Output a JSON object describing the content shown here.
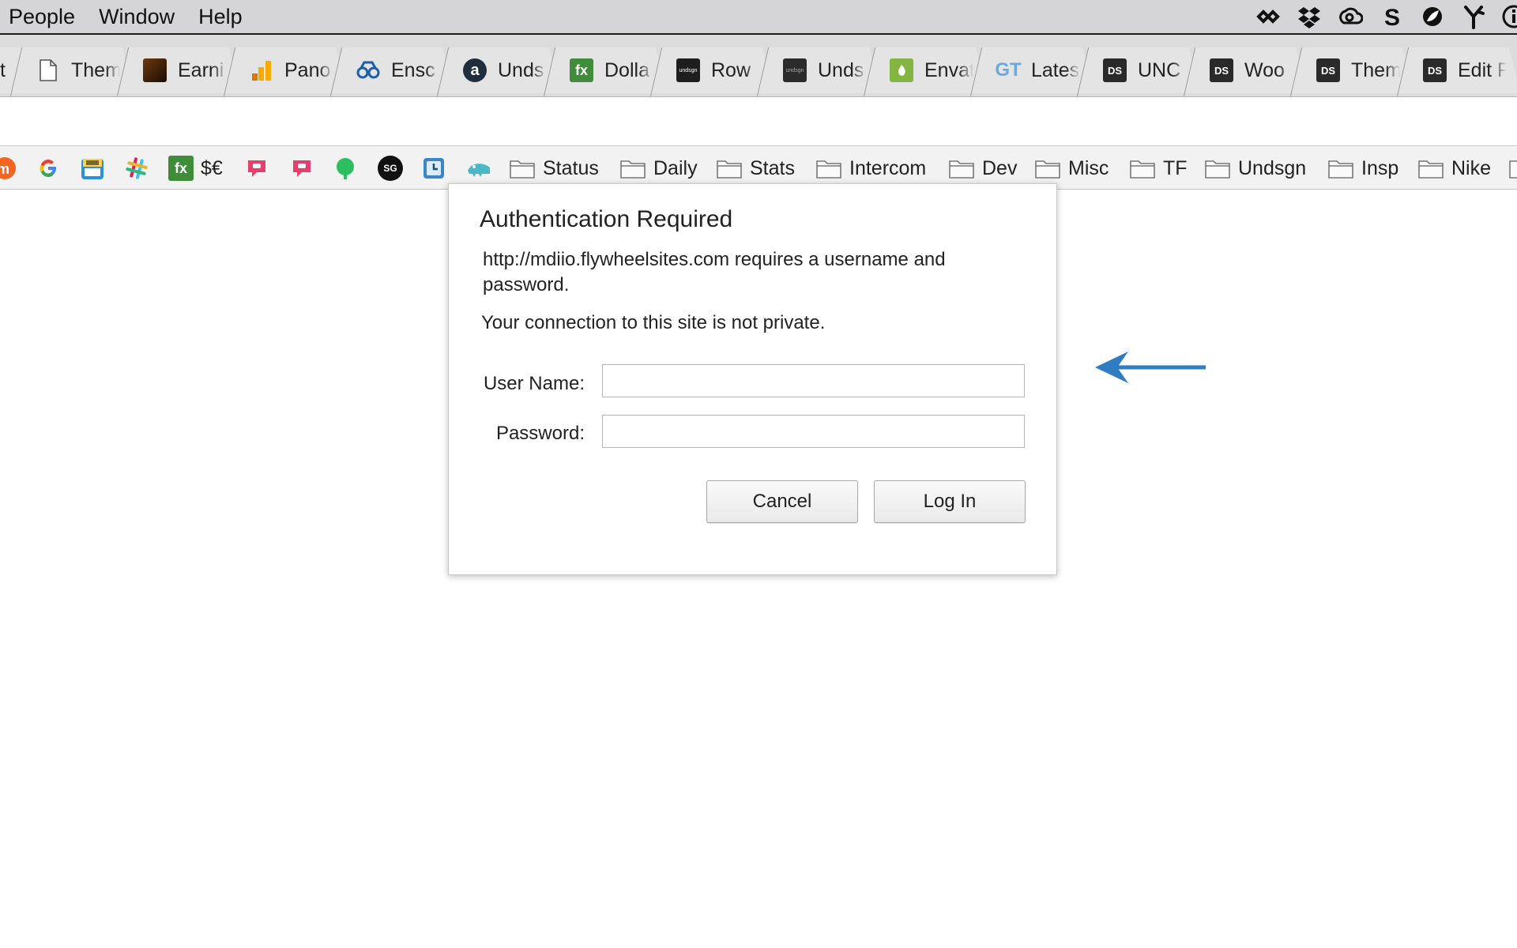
{
  "menubar": {
    "items": [
      "People",
      "Window",
      "Help"
    ],
    "extras": [
      "link-icon",
      "dropbox-icon",
      "creative-cloud-icon",
      "scrivener-icon",
      "leaf-icon",
      "branch-icon",
      "info-icon"
    ]
  },
  "tabs": [
    {
      "title": "Them",
      "icon": "page-icon"
    },
    {
      "title": "Earni",
      "icon": "earnings-icon"
    },
    {
      "title": "Pano",
      "icon": "analytics-icon"
    },
    {
      "title": "Ensc",
      "icon": "binoculars-icon"
    },
    {
      "title": "Unds",
      "icon": "amazon-icon"
    },
    {
      "title": "Dolla",
      "icon": "fx-icon",
      "fav_text": "fx"
    },
    {
      "title": "Row",
      "icon": "undsgn-icon",
      "fav_text": "undsgn"
    },
    {
      "title": "Unds",
      "icon": "undsgn-icon",
      "fav_text": "undsgn"
    },
    {
      "title": "Envat",
      "icon": "envato-icon"
    },
    {
      "title": "Lates",
      "icon": "gt-icon",
      "fav_text": "GT"
    },
    {
      "title": "UNC",
      "icon": "ds-icon",
      "fav_text": "DS"
    },
    {
      "title": "Woo",
      "icon": "ds-icon",
      "fav_text": "DS"
    },
    {
      "title": "Them",
      "icon": "ds-icon",
      "fav_text": "DS"
    },
    {
      "title": "Edit F",
      "icon": "ds-icon",
      "fav_text": "DS"
    }
  ],
  "bookmarks": {
    "currency_label": "$€",
    "fx_label": "fx",
    "sg_label": "SG",
    "folders": [
      "Status",
      "Daily",
      "Stats",
      "Intercom",
      "Dev",
      "Misc",
      "TF",
      "Undsgn",
      "Insp",
      "Nike"
    ]
  },
  "dialog": {
    "title": "Authentication Required",
    "message": "http://mdiio.flywheelsites.com requires a username and password.",
    "warning": "Your connection to this site is not private.",
    "username_label": "User Name:",
    "password_label": "Password:",
    "username_value": "",
    "password_value": "",
    "cancel_label": "Cancel",
    "login_label": "Log In"
  },
  "colors": {
    "arrow": "#2f7cc0",
    "fx_green": "#3f8c3a",
    "ds_dark": "#2a2a2a",
    "envato_green": "#82b541",
    "gt_blue": "#6aa8e0"
  }
}
